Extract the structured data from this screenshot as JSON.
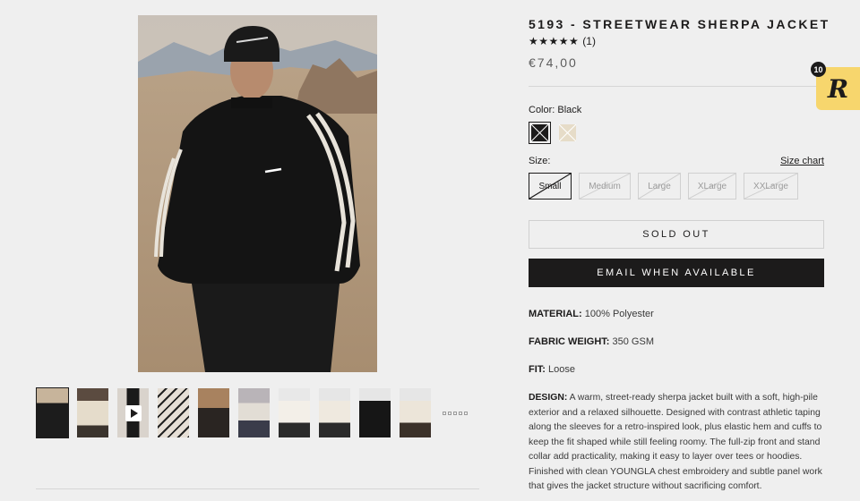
{
  "product": {
    "title": "5193 - STREETWEAR SHERPA JACKET",
    "stars": "★★★★★",
    "rating_count": "(1)",
    "price": "€74,00"
  },
  "color": {
    "label_prefix": "Color:",
    "selected": "Black",
    "swatches": [
      {
        "name": "Black",
        "hex": "#1c1b1b",
        "available": false,
        "selected": true
      },
      {
        "name": "Cream",
        "hex": "#e6dcc8",
        "available": false,
        "selected": false
      }
    ]
  },
  "size": {
    "label": "Size:",
    "chart_link": "Size chart",
    "options": [
      {
        "label": "Small",
        "selected": true,
        "available": false
      },
      {
        "label": "Medium",
        "selected": false,
        "available": false
      },
      {
        "label": "Large",
        "selected": false,
        "available": false
      },
      {
        "label": "XLarge",
        "selected": false,
        "available": false
      },
      {
        "label": "XXLarge",
        "selected": false,
        "available": false
      }
    ]
  },
  "buttons": {
    "sold_out": "SOLD OUT",
    "email": "EMAIL WHEN AVAILABLE"
  },
  "specs": {
    "material_label": "MATERIAL:",
    "material_value": "100% Polyester",
    "weight_label": "FABRIC WEIGHT:",
    "weight_value": "350 GSM",
    "fit_label": "FIT:",
    "fit_value": "Loose",
    "design_label": "DESIGN:",
    "design_value": "A warm, street-ready sherpa jacket built with a soft, high-pile exterior and a relaxed silhouette. Designed with contrast athletic taping along the sleeves for a retro-inspired look, plus elastic hem and cuffs to keep the fit shaped while still feeling roomy. The full-zip front and stand collar add practicality, making it easy to layer over tees or hoodies. Finished with clean YOUNGLA chest embroidery and subtle panel work that gives the jacket structure without sacrificing comfort."
  },
  "rewards": {
    "logo": "R",
    "badge": "10"
  },
  "colors": {
    "accent": "#1c1b1b",
    "widget": "#f7d66d",
    "background": "#efefef"
  }
}
